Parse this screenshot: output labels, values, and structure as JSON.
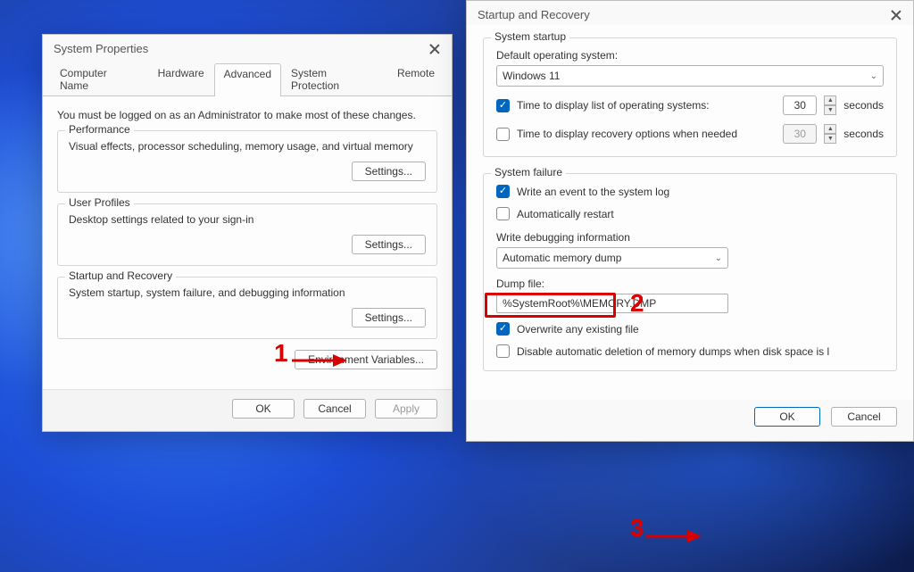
{
  "dlg1": {
    "title": "System Properties",
    "tabs": [
      "Computer Name",
      "Hardware",
      "Advanced",
      "System Protection",
      "Remote"
    ],
    "active_tab": 2,
    "admin_note": "You must be logged on as an Administrator to make most of these changes.",
    "perf": {
      "legend": "Performance",
      "desc": "Visual effects, processor scheduling, memory usage, and virtual memory",
      "settings_btn": "Settings..."
    },
    "profiles": {
      "legend": "User Profiles",
      "desc": "Desktop settings related to your sign-in",
      "settings_btn": "Settings..."
    },
    "startup": {
      "legend": "Startup and Recovery",
      "desc": "System startup, system failure, and debugging information",
      "settings_btn": "Settings..."
    },
    "env_btn": "Environment Variables...",
    "ok": "OK",
    "cancel": "Cancel",
    "apply": "Apply"
  },
  "dlg2": {
    "title": "Startup and Recovery",
    "startup": {
      "legend": "System startup",
      "default_os_label": "Default operating system:",
      "default_os_value": "Windows 11",
      "time_list_checked": true,
      "time_list_label": "Time to display list of operating systems:",
      "time_list_value": "30",
      "time_recovery_checked": false,
      "time_recovery_label": "Time to display recovery options when needed",
      "time_recovery_value": "30",
      "seconds_label": "seconds"
    },
    "failure": {
      "legend": "System failure",
      "write_event_checked": true,
      "write_event_label": "Write an event to the system log",
      "auto_restart_checked": false,
      "auto_restart_label": "Automatically restart",
      "write_debug_label": "Write debugging information",
      "dump_type": "Automatic memory dump",
      "dump_file_label": "Dump file:",
      "dump_file_value": "%SystemRoot%\\MEMORY.DMP",
      "overwrite_checked": true,
      "overwrite_label": "Overwrite any existing file",
      "disable_delete_checked": false,
      "disable_delete_label": "Disable automatic deletion of memory dumps when disk space is l"
    },
    "ok": "OK",
    "cancel": "Cancel"
  },
  "annotations": {
    "n1": "1",
    "n2": "2",
    "n3": "3"
  }
}
